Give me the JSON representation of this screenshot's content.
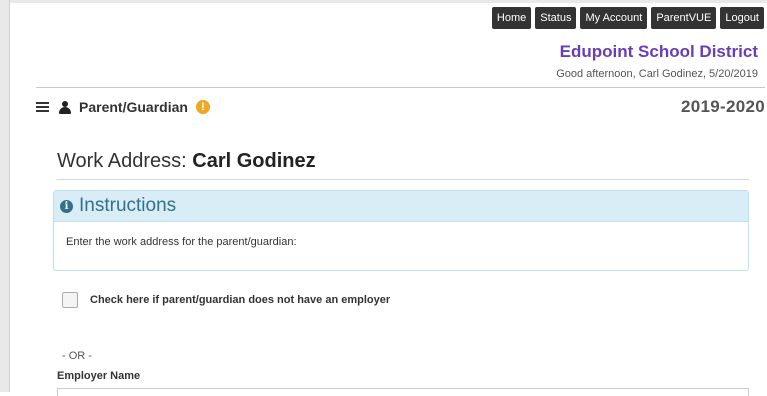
{
  "topnav": {
    "items": [
      "Home",
      "Status",
      "My Account",
      "ParentVUE",
      "Logout"
    ]
  },
  "header": {
    "district": "Edupoint School District",
    "greeting": "Good afternoon, Carl Godinez, 5/20/2019"
  },
  "toolbar": {
    "section_label": "Parent/Guardian",
    "warning_symbol": "!",
    "school_year": "2019-2020"
  },
  "page": {
    "title_prefix": "Work Address:",
    "title_name": "Carl Godinez"
  },
  "instructions": {
    "heading": "Instructions",
    "icon_symbol": "i",
    "text": "Enter the work address for the parent/guardian:"
  },
  "form": {
    "no_employer_label": "Check here if parent/guardian does not have an employer",
    "no_employer_checked": false,
    "or_text": "- OR -",
    "employer_name_label": "Employer Name",
    "employer_name_value": ""
  },
  "colors": {
    "nav_button": "#333333",
    "district": "#6a3db8",
    "info_panel_bg": "#d9edf7",
    "info_panel_text": "#31708f",
    "warning": "#f0a824"
  },
  "icons": [
    "menu-icon",
    "user-icon",
    "warning-icon",
    "info-icon"
  ]
}
